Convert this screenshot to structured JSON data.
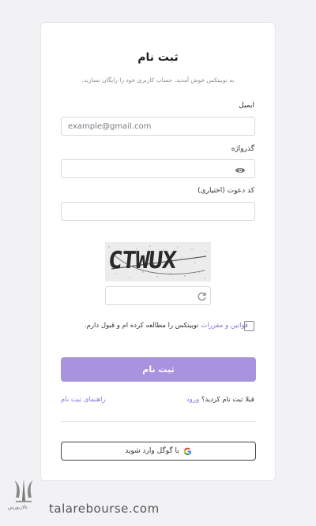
{
  "form": {
    "title": "ثبت نام",
    "subtitle": "به نوبیتکس خوش آمدید. حساب کاربری خود را رایگان بسازید.",
    "email_label": "ایمیل",
    "email_placeholder": "example@gmail.com",
    "password_label": "گذرواژه",
    "invite_label": "کد دعوت (اختیاری)",
    "captcha_text": "CTWUX",
    "terms_link": "قوانین و مقررات",
    "terms_text": " نوبیتکس را مطالعه کرده ام و قبول دارم.",
    "submit_label": "ثبت نام",
    "already_question": "قبلا ثبت نام کردید؟",
    "login_link": "ورود",
    "guide_link": "راهنمای ثبت نام",
    "google_label": "با گوگل وارد شوید"
  },
  "watermark": {
    "url": "talarebourse.com",
    "brand": "تالاربورس"
  },
  "colors": {
    "accent": "#a993df",
    "link": "#8f6fd6",
    "background": "#f2f2f5"
  },
  "icons": [
    "eye-icon",
    "refresh-icon",
    "google-icon"
  ]
}
